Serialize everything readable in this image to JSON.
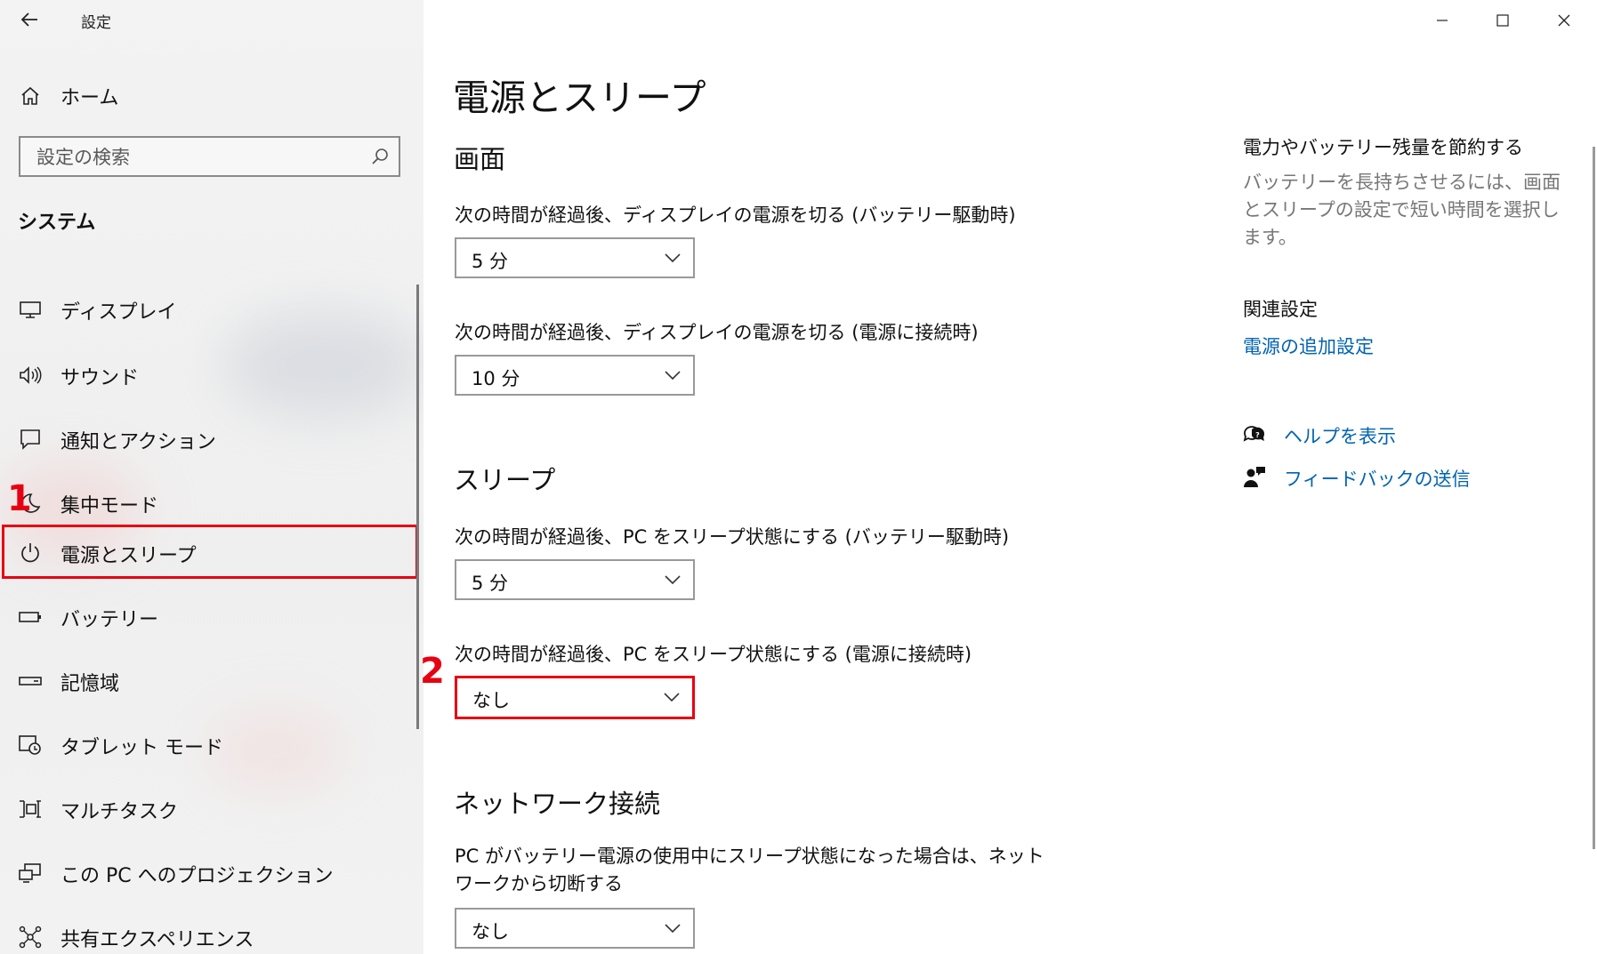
{
  "window": {
    "app_title": "設定",
    "controls": [
      "minimize-icon",
      "maximize-icon",
      "close-icon"
    ]
  },
  "sidebar": {
    "home_label": "ホーム",
    "search_placeholder": "設定の検索",
    "section_title": "システム",
    "items": [
      {
        "label": "ディスプレイ",
        "icon": "display-icon"
      },
      {
        "label": "サウンド",
        "icon": "sound-icon"
      },
      {
        "label": "通知とアクション",
        "icon": "notification-icon"
      },
      {
        "label": "集中モード",
        "icon": "focus-assist-icon"
      },
      {
        "label": "電源とスリープ",
        "icon": "power-icon",
        "selected": true
      },
      {
        "label": "バッテリー",
        "icon": "battery-icon"
      },
      {
        "label": "記憶域",
        "icon": "storage-icon"
      },
      {
        "label": "タブレット モード",
        "icon": "tablet-mode-icon"
      },
      {
        "label": "マルチタスク",
        "icon": "multitasking-icon"
      },
      {
        "label": "この PC へのプロジェクション",
        "icon": "projection-icon"
      },
      {
        "label": "共有エクスペリエンス",
        "icon": "shared-experience-icon"
      }
    ]
  },
  "annotations": {
    "step1": "1",
    "step2": "2",
    "highlight_color": "#e60012"
  },
  "main": {
    "title": "電源とスリープ",
    "screen": {
      "heading": "画面",
      "battery_label": "次の時間が経過後、ディスプレイの電源を切る (バッテリー駆動時)",
      "battery_value": "5 分",
      "plugged_label": "次の時間が経過後、ディスプレイの電源を切る (電源に接続時)",
      "plugged_value": "10 分"
    },
    "sleep": {
      "heading": "スリープ",
      "battery_label": "次の時間が経過後、PC をスリープ状態にする (バッテリー駆動時)",
      "battery_value": "5 分",
      "plugged_label": "次の時間が経過後、PC をスリープ状態にする (電源に接続時)",
      "plugged_value": "なし"
    },
    "network": {
      "heading": "ネットワーク接続",
      "description": "PC がバッテリー電源の使用中にスリープ状態になった場合は、ネットワークから切断する",
      "value": "なし"
    }
  },
  "right_pane": {
    "save_heading": "電力やバッテリー残量を節約する",
    "save_desc": "バッテリーを長持ちさせるには、画面とスリープの設定で短い時間を選択します。",
    "related_heading": "関連設定",
    "related_link": "電源の追加設定",
    "help_link": "ヘルプを表示",
    "feedback_link": "フィードバックの送信",
    "link_color": "#0063b1"
  }
}
